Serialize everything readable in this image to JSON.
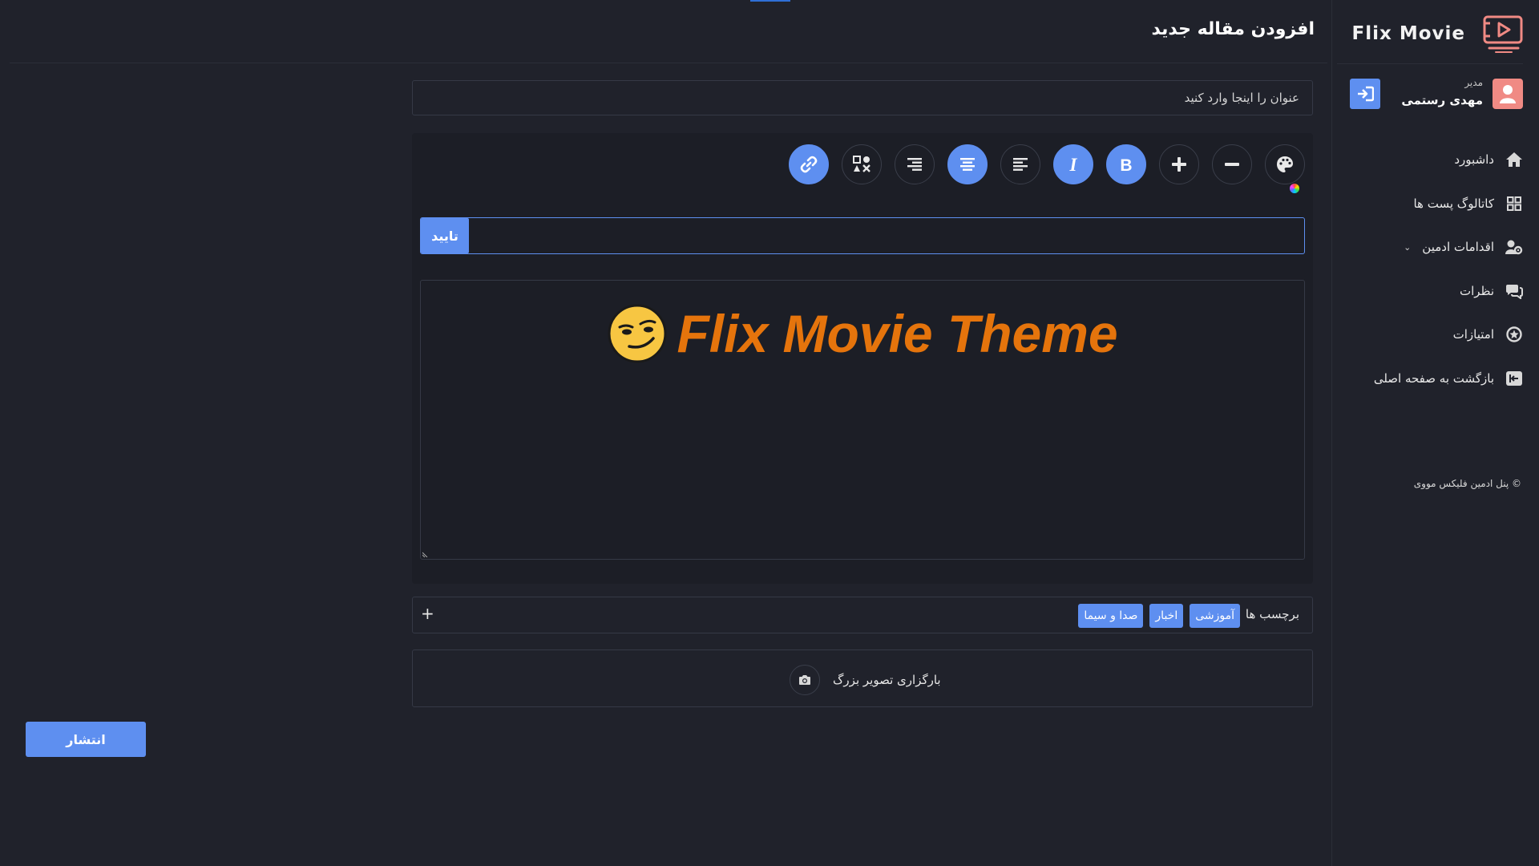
{
  "brand": {
    "name": "Flix Movie",
    "logo_icon": "video-play-icon"
  },
  "user": {
    "role": "مدیر",
    "name": "مهدی رستمی"
  },
  "nav": {
    "items": [
      {
        "label": "داشبورد",
        "icon": "home-icon"
      },
      {
        "label": "کاتالوگ پست ها",
        "icon": "grid-icon"
      },
      {
        "label": "اقدامات ادمین",
        "icon": "admin-gear-icon",
        "has_dropdown": true
      },
      {
        "label": "نظرات",
        "icon": "comments-icon"
      },
      {
        "label": "امتیازات",
        "icon": "star-icon"
      },
      {
        "label": "بازگشت به صفحه اصلی",
        "icon": "back-home-icon"
      }
    ]
  },
  "footer": {
    "note": "© پنل ادمین فلیکس مووی"
  },
  "page": {
    "title": "افزودن مقاله جدید"
  },
  "form": {
    "title_placeholder": "عنوان را اینجا وارد کنید",
    "confirm_label": "تایید",
    "editor_content": "Flix Movie Theme",
    "editor_emoji": "smirking-face",
    "tags_label": "برچسب ها",
    "tags": [
      "آموزشی",
      "اخبار",
      "صدا و سیما"
    ],
    "tag_add": "+",
    "upload_label": "بارگزاری تصویر بزرگ",
    "publish_label": "انتشار"
  },
  "colors": {
    "background": "#20222b",
    "editor_bg": "#1c1e26",
    "accent": "#5e8ff0",
    "avatar": "#f08a84",
    "logo": "#f08a84",
    "heading": "#e5740c"
  }
}
